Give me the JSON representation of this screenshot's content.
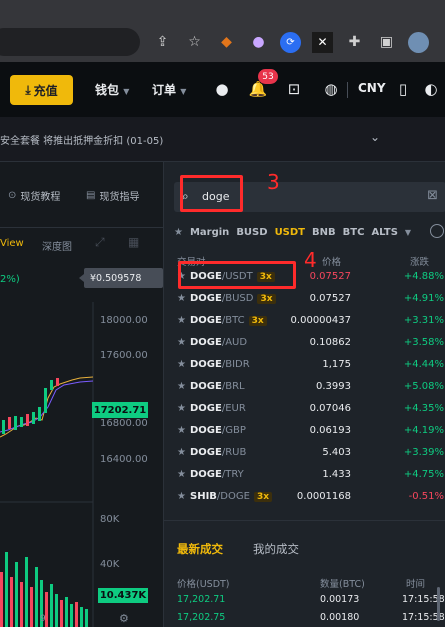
{
  "browser": {
    "icons": [
      "share-icon",
      "bookmark-star-icon",
      "metamask-extension-icon",
      "extension-icon",
      "extension-icon",
      "extension-icon",
      "puzzle-extensions-icon",
      "sidebar-icon",
      "profile-avatar-icon"
    ]
  },
  "header": {
    "deposit_label": "充值",
    "wallet_label": "钱包",
    "orders_label": "订单",
    "notification_count": "53",
    "currency_label": "CNY"
  },
  "announcement": {
    "text": "安全套餐 将推出抵押金折扣 (01-05)"
  },
  "chart_panel": {
    "tutorial_label": "现货教程",
    "guide_label": "现货指导",
    "view_tab": "View",
    "depth_tab": "深度图",
    "pct_label": "2%)",
    "price_tag": "¥0.509578",
    "axis_labels": [
      "18000.00",
      "17600.00",
      "16800.00",
      "16400.00"
    ],
    "current_price": "17202.71",
    "vol_labels": [
      "80K",
      "40K"
    ],
    "current_vol": "10.437K",
    "bottom_tick": "9"
  },
  "search": {
    "value": "doge"
  },
  "filters": {
    "items": [
      "Margin",
      "BUSD",
      "USDT",
      "BNB",
      "BTC",
      "ALTS"
    ],
    "active": "USDT"
  },
  "columns": {
    "pair": "交易对",
    "price": "价格",
    "change": "涨跌"
  },
  "pairs": [
    {
      "base": "DOGE",
      "quote": "/USDT",
      "lev": "3x",
      "price": "0.07527",
      "change": "+4.88%",
      "price_dir": "down",
      "chg_dir": "up"
    },
    {
      "base": "DOGE",
      "quote": "/BUSD",
      "lev": "3x",
      "price": "0.07527",
      "change": "+4.91%",
      "price_dir": "up",
      "chg_dir": "up"
    },
    {
      "base": "DOGE",
      "quote": "/BTC",
      "lev": "3x",
      "price": "0.00000437",
      "change": "+3.31%",
      "price_dir": "up",
      "chg_dir": "up"
    },
    {
      "base": "DOGE",
      "quote": "/AUD",
      "lev": "",
      "price": "0.10862",
      "change": "+3.58%",
      "price_dir": "up",
      "chg_dir": "up"
    },
    {
      "base": "DOGE",
      "quote": "/BIDR",
      "lev": "",
      "price": "1,175",
      "change": "+4.44%",
      "price_dir": "up",
      "chg_dir": "up"
    },
    {
      "base": "DOGE",
      "quote": "/BRL",
      "lev": "",
      "price": "0.3993",
      "change": "+5.08%",
      "price_dir": "up",
      "chg_dir": "up"
    },
    {
      "base": "DOGE",
      "quote": "/EUR",
      "lev": "",
      "price": "0.07046",
      "change": "+4.35%",
      "price_dir": "up",
      "chg_dir": "up"
    },
    {
      "base": "DOGE",
      "quote": "/GBP",
      "lev": "",
      "price": "0.06193",
      "change": "+4.19%",
      "price_dir": "up",
      "chg_dir": "up"
    },
    {
      "base": "DOGE",
      "quote": "/RUB",
      "lev": "",
      "price": "5.403",
      "change": "+3.39%",
      "price_dir": "up",
      "chg_dir": "up"
    },
    {
      "base": "DOGE",
      "quote": "/TRY",
      "lev": "",
      "price": "1.433",
      "change": "+4.75%",
      "price_dir": "up",
      "chg_dir": "up"
    },
    {
      "base": "SHIB",
      "quote": "/DOGE",
      "lev": "3x",
      "price": "0.0001168",
      "change": "-0.51%",
      "price_dir": "up",
      "chg_dir": "down"
    }
  ],
  "annotations": {
    "label_search": "3",
    "label_row": "4"
  },
  "trades": {
    "tab_market": "最新成交",
    "tab_mine": "我的成交",
    "col_price": "价格(USDT)",
    "col_qty": "数量(BTC)",
    "col_time": "时间",
    "rows": [
      {
        "price": "17,202.71",
        "qty": "0.00173",
        "time": "17:15:58"
      },
      {
        "price": "17,202.75",
        "qty": "0.00180",
        "time": "17:15:58"
      }
    ]
  },
  "colors": {
    "accent": "#f0b90b",
    "up": "#0ecb81",
    "down": "#f6465d",
    "annotation": "#ff2b2b"
  }
}
